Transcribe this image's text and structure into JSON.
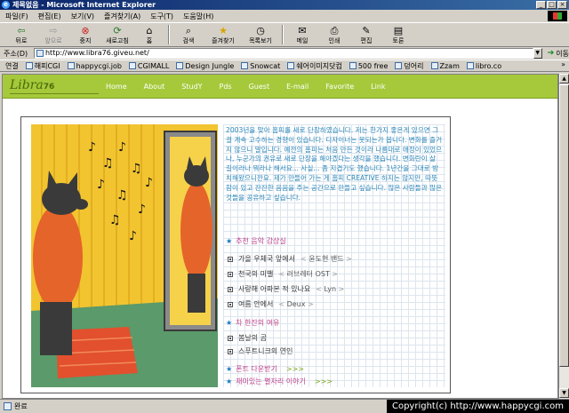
{
  "window": {
    "title": "제목없음 - Microsoft Internet Explorer"
  },
  "menu": [
    "파일(F)",
    "편집(E)",
    "보기(V)",
    "즐겨찾기(A)",
    "도구(T)",
    "도움말(H)"
  ],
  "toolbar": {
    "back": "뒤로",
    "forward": "앞으로",
    "stop": "중지",
    "refresh": "새로고침",
    "home": "홈",
    "search": "검색",
    "favorites": "즐겨찾기",
    "history": "목록보기",
    "mail": "메일",
    "print": "인쇄",
    "edit": "편집",
    "discuss": "토론"
  },
  "address": {
    "label": "주소(D)",
    "url": "http://www.libra76.giveu.net/",
    "go": "이동"
  },
  "links": {
    "label": "연결",
    "items": [
      "해피CGI",
      "happycgi.job",
      "CGIMALL",
      "Design Jungle",
      "Snowcat",
      "쉐어이미지닷컴",
      "500 free",
      "덩어리",
      "Zzam",
      "libro.co"
    ]
  },
  "site": {
    "logo_text": "Libra",
    "logo_num": "76",
    "nav": [
      "Home",
      "About",
      "StudY",
      "Pds",
      "Guest",
      "E-mail",
      "Favorite",
      "Link"
    ],
    "intro": "2003년을 맞아 홈피를 새로 단장하였습니다. 저는 한가지 좋은게 있으면 그걸 계속 고수하는 경향이 있습니다. 디자이너는 못되는가 봅니다. 변화를 즐거지 않으니 말입니다. 예전의 홈피는 처음 만든 것이라 나름대로 애정이 있었으나, 누군가의 권유로 새로 단장을 해야겠다는 생각을 했습니다. 변화란이 살 길이라나 뭐라나 해서요... 사실... 좀 지겹기도 했습니다. 1년간을 그대로 방치해왔으니깐요. 제가 만들어 가는 게 홈피 CREATIVE 하지는 않지만, 따뜻함이 있고 잔잔한 음음을 주는 공간으로 만들고 싶습니다. 많은 사람들과 많은 것들을 공유하고 싶습니다.",
    "music_title": "추천 음악 감상실",
    "songs": [
      {
        "title": "가을 우체국 앞에서",
        "artist": "윤도현 밴드"
      },
      {
        "title": "천국의 미밸",
        "artist": "러브레터 OST"
      },
      {
        "title": "사랑해 아파본 적 있나요",
        "artist": "Lyn"
      },
      {
        "title": "여름 안에서",
        "artist": "Deux"
      }
    ],
    "books_title": "차 한잔의 여유",
    "books": [
      "봄날의 곰",
      "스푸트니크의 연인"
    ],
    "font_download": "폰트 다운받기",
    "fun_stories": "재미있는 별자리 이야기",
    "chevrons": ">>>"
  },
  "status": {
    "text": "완료"
  },
  "copyright": "Copyright(c) http://www.happycgi.com"
}
